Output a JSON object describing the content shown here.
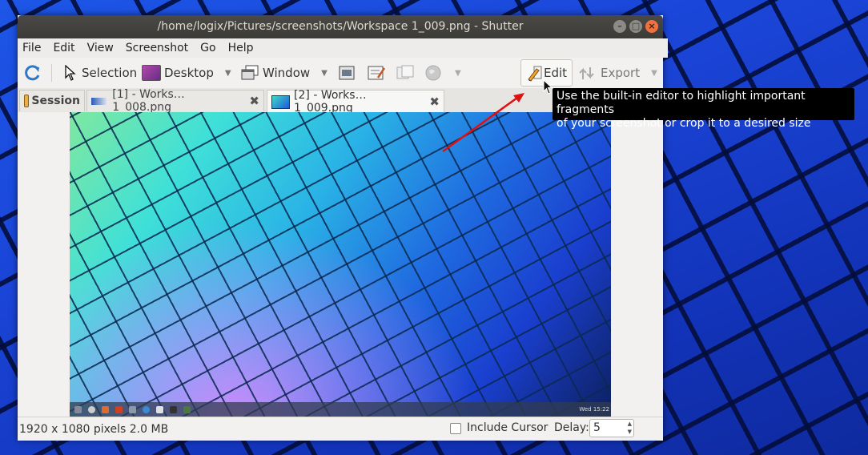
{
  "window": {
    "title": "/home/logix/Pictures/screenshots/Workspace 1_009.png - Shutter"
  },
  "menu": [
    "File",
    "Edit",
    "View",
    "Screenshot",
    "Go",
    "Help"
  ],
  "toolbar": {
    "selection": "Selection",
    "desktop": "Desktop",
    "window": "Window",
    "edit": "Edit",
    "export": "Export"
  },
  "tabs": [
    {
      "label": "Session"
    },
    {
      "label": "[1] - Works… 1_008.png"
    },
    {
      "label": "[2] - Works… 1_009.png"
    }
  ],
  "status": {
    "info": "1920 x 1080 pixels  2.0 MB",
    "include_cursor": "Include Cursor",
    "include_cursor_checked": false,
    "delay_label": "Delay:",
    "delay_value": "5"
  },
  "tooltip": {
    "line1": "Use the built-in editor to highlight important fragments",
    "line2": "of your screenshot or crop it to a desired size"
  },
  "preview": {
    "clock": "Wed 15:22"
  },
  "colors": {
    "titlebar": "#3c3b37",
    "close_button": "#f0713f",
    "annotation_arrow": "#e01010"
  }
}
